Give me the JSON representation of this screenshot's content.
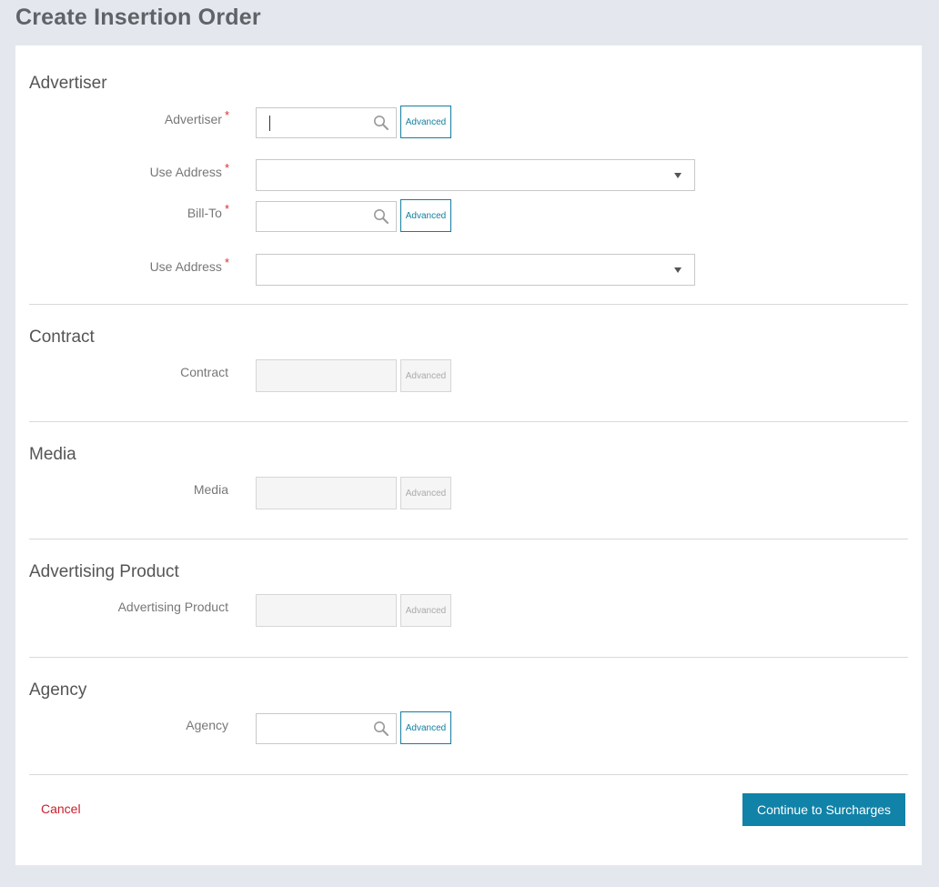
{
  "page": {
    "title": "Create Insertion Order"
  },
  "advertiser": {
    "section_title": "Advertiser",
    "advertiser_label": "Advertiser",
    "use_address_label": "Use Address",
    "bill_to_label": "Bill-To",
    "use_address2_label": "Use Address",
    "advanced_label": "Advanced",
    "required_mark": "*"
  },
  "contract": {
    "section_title": "Contract",
    "label": "Contract",
    "advanced_label": "Advanced"
  },
  "media": {
    "section_title": "Media",
    "label": "Media",
    "advanced_label": "Advanced"
  },
  "advertising_product": {
    "section_title": "Advertising Product",
    "label": "Advertising Product",
    "advanced_label": "Advanced"
  },
  "agency": {
    "section_title": "Agency",
    "label": "Agency",
    "advanced_label": "Advanced"
  },
  "footer": {
    "cancel_label": "Cancel",
    "continue_label": "Continue to Surcharges"
  },
  "colors": {
    "accent": "#1182a8",
    "cancel": "#c8202a",
    "required": "#d63030"
  },
  "icons": {
    "search": "search-icon",
    "dropdown": "caret-down-icon"
  }
}
